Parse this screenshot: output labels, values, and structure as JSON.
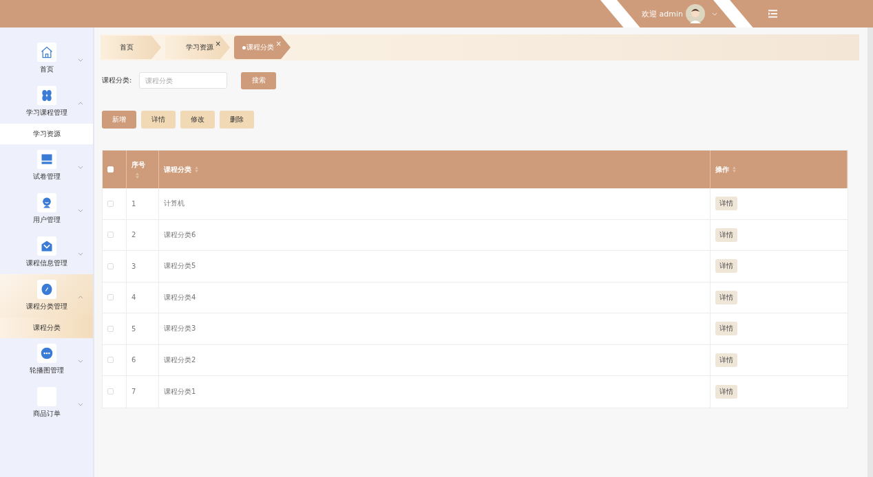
{
  "header": {
    "greeting": "欢迎 admin"
  },
  "sidebar": {
    "items": [
      {
        "label": "首页",
        "expanded": false,
        "selected": false
      },
      {
        "label": "学习课程管理",
        "expanded": true,
        "selected": false,
        "children": [
          {
            "label": "学习资源",
            "selected": false
          }
        ]
      },
      {
        "label": "试卷管理",
        "expanded": false,
        "selected": false
      },
      {
        "label": "用户管理",
        "expanded": false,
        "selected": false
      },
      {
        "label": "课程信息管理",
        "expanded": false,
        "selected": false
      },
      {
        "label": "课程分类管理",
        "expanded": true,
        "selected": true,
        "children": [
          {
            "label": "课程分类",
            "selected": true
          }
        ]
      },
      {
        "label": "轮播图管理",
        "expanded": false,
        "selected": false
      },
      {
        "label": "商品订单",
        "expanded": false,
        "selected": false
      }
    ]
  },
  "tabs": [
    {
      "label": "首页",
      "selected": false
    },
    {
      "label": "学习资源",
      "selected": false,
      "close": "×"
    },
    {
      "label": "课程分类",
      "selected": true,
      "close": "×"
    }
  ],
  "search": {
    "label": "课程分类:",
    "placeholder": "课程分类",
    "button": "搜索"
  },
  "actions": [
    {
      "label": "新增",
      "primary": true
    },
    {
      "label": "详情",
      "primary": false
    },
    {
      "label": "修改",
      "primary": false
    },
    {
      "label": "删除",
      "primary": false
    }
  ],
  "table": {
    "header_checked": false,
    "columns": [
      "序号",
      "课程分类",
      "操作"
    ],
    "rows": [
      {
        "checked": false,
        "index": "1",
        "name": "计算机",
        "action": "详情"
      },
      {
        "checked": false,
        "index": "2",
        "name": "课程分类6",
        "action": "详情"
      },
      {
        "checked": false,
        "index": "3",
        "name": "课程分类5",
        "action": "详情"
      },
      {
        "checked": false,
        "index": "4",
        "name": "课程分类4",
        "action": "详情"
      },
      {
        "checked": false,
        "index": "5",
        "name": "课程分类3",
        "action": "详情"
      },
      {
        "checked": false,
        "index": "6",
        "name": "课程分类2",
        "action": "详情"
      },
      {
        "checked": false,
        "index": "7",
        "name": "课程分类1",
        "action": "详情"
      }
    ]
  }
}
